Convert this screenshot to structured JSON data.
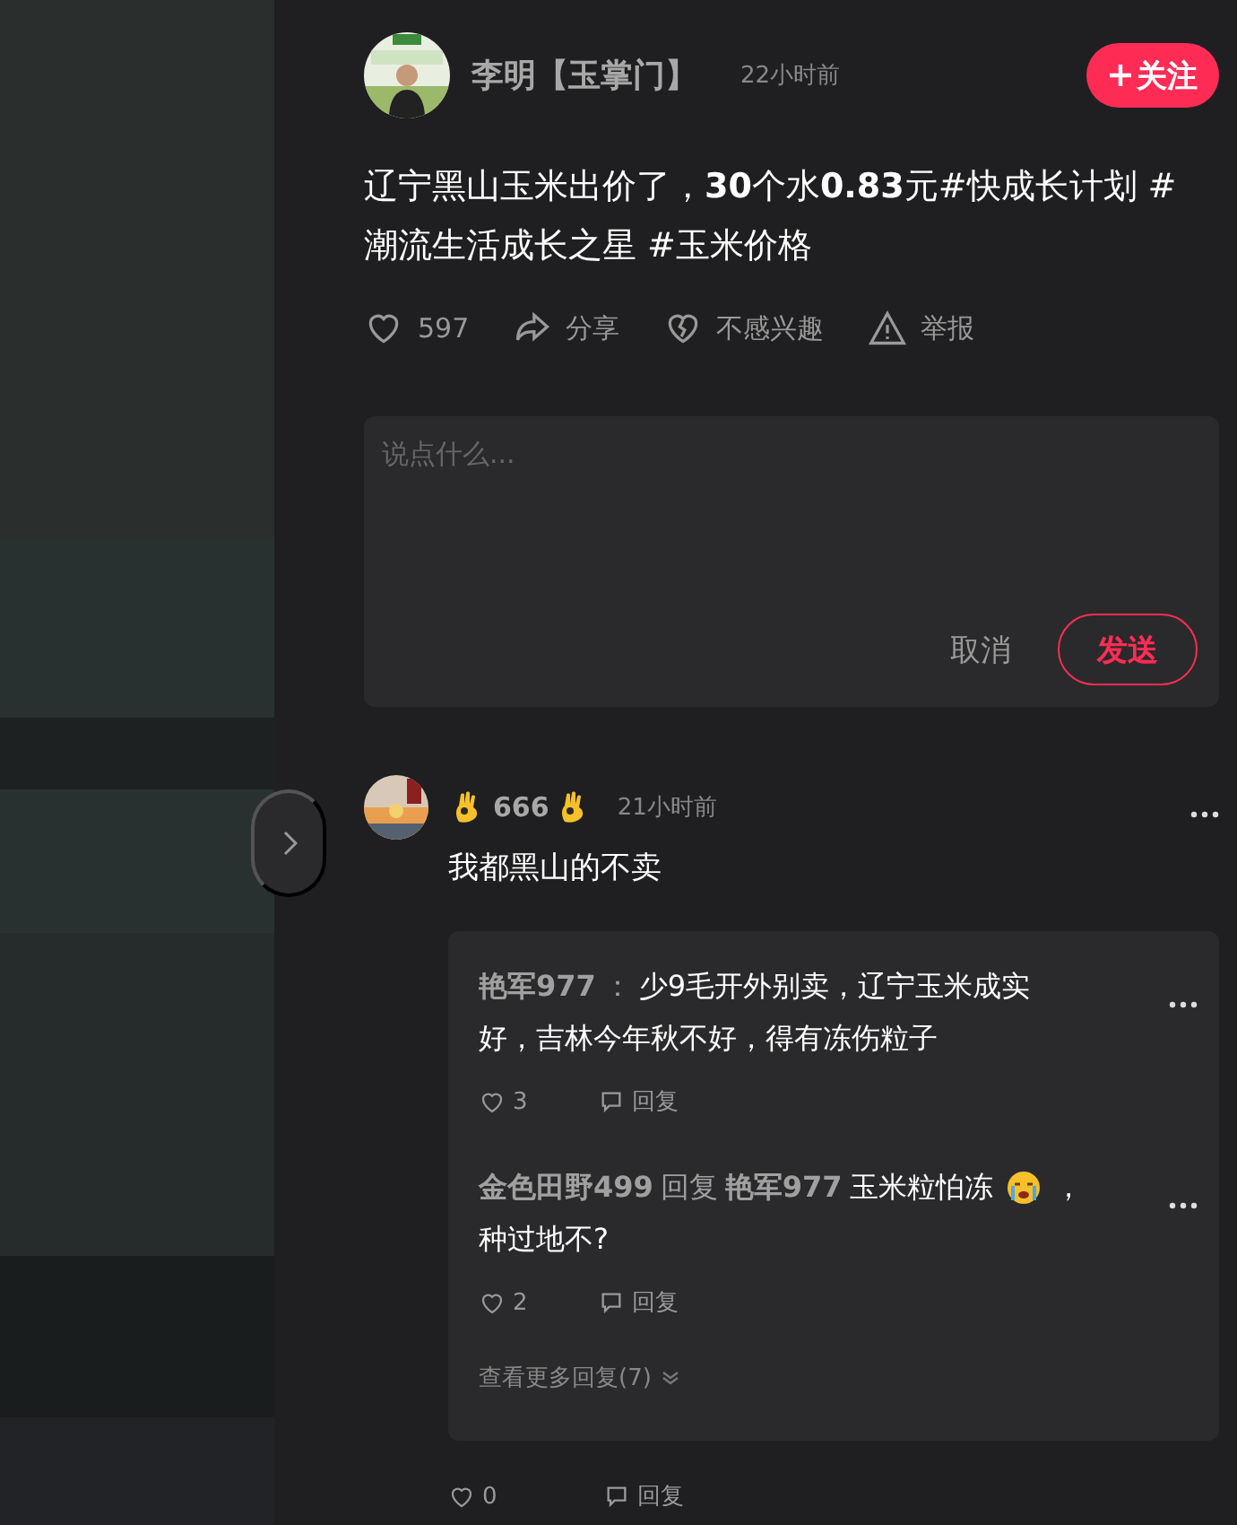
{
  "post": {
    "author": "李明【玉掌门】",
    "time": "22小时前",
    "follow_label": "关注",
    "text": "辽宁黑山玉米出价了，**30**个水**0.83**元#快成长计划 #潮流生活成长之星 #玉米价格",
    "actions": [
      {
        "kind": "like",
        "label": "597"
      },
      {
        "kind": "share",
        "label": "分享"
      },
      {
        "kind": "dislike",
        "label": "不感兴趣"
      },
      {
        "kind": "report",
        "label": "举报"
      }
    ]
  },
  "comment_box": {
    "placeholder": "说点什么...",
    "cancel": "取消",
    "send": "发送"
  },
  "comment": {
    "name": "666",
    "time": "21小时前",
    "text": "我都黑山的不卖",
    "replies": [
      {
        "author": "艳军977",
        "separator": "：",
        "text": "少9毛开外别卖，辽宁玉米成实",
        "emoji": false,
        "continuation": "好，吉林今年秋不好，得有冻伤粒子",
        "likes": "3",
        "reply": "回复"
      },
      {
        "author": "金色田野499",
        "reply_word": "回复",
        "target": "艳军977",
        "text": "玉米粒怕冻",
        "emoji": true,
        "text_after": "，",
        "continuation": "种过地不?",
        "likes": "2",
        "reply": "回复"
      }
    ],
    "more_replies": "查看更多回复(7)",
    "likes": "0",
    "reply": "回复"
  }
}
